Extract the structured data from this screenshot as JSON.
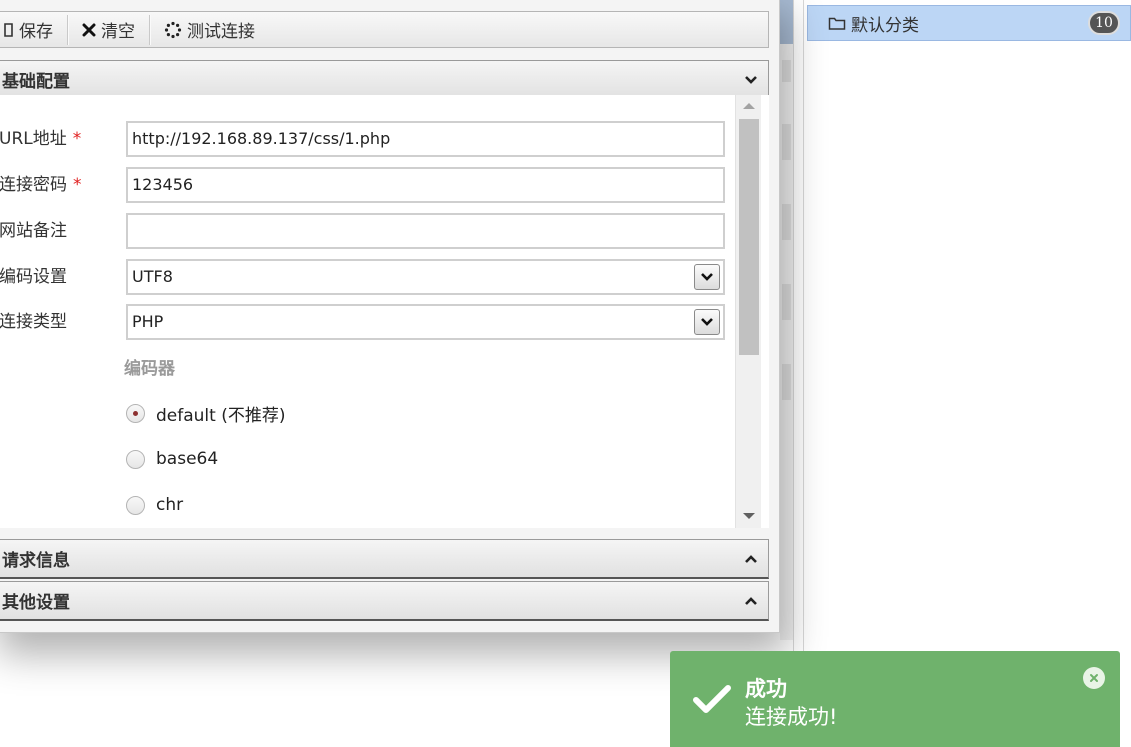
{
  "toolbar": {
    "save_label": "保存",
    "clear_label": "清空",
    "test_label": "测试连接"
  },
  "sections": {
    "basic": "基础配置",
    "request": "请求信息",
    "other": "其他设置"
  },
  "form": {
    "url": {
      "label": "URL地址",
      "required_mark": "*",
      "value": "http://192.168.89.137/css/1.php"
    },
    "password": {
      "label": "连接密码",
      "required_mark": "*",
      "value": "123456"
    },
    "note": {
      "label": "网站备注",
      "value": ""
    },
    "encoding": {
      "label": "编码设置",
      "value": "UTF8"
    },
    "type": {
      "label": "连接类型",
      "value": "PHP"
    },
    "encoder": {
      "title": "编码器",
      "options": [
        {
          "label": "default (不推荐)",
          "checked": true
        },
        {
          "label": "base64",
          "checked": false
        },
        {
          "label": "chr",
          "checked": false
        }
      ]
    }
  },
  "tree": {
    "item_label": "默认分类",
    "count": "10"
  },
  "toast": {
    "title": "成功",
    "message": "连接成功!",
    "color": "#6fb26c"
  }
}
